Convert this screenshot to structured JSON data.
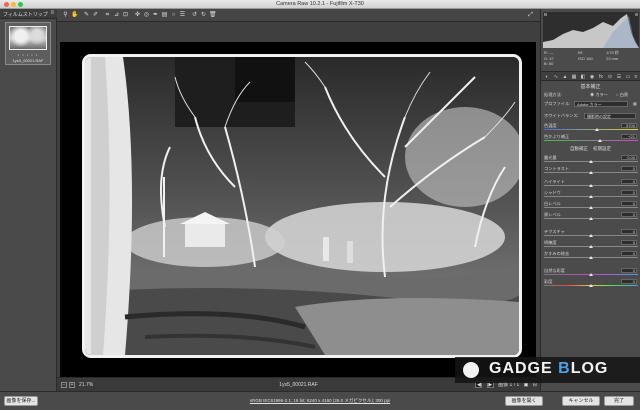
{
  "window": {
    "title": "Camera Raw 10.2.1 - Fujifilm X-T30"
  },
  "filmstrip": {
    "title": "フィルムストリップ",
    "menu_icon": "menu-icon",
    "thumb": {
      "stars": "• • • • •",
      "filename": "1ys5_00021.RAF"
    }
  },
  "toolbar": {
    "tools": [
      "zoom-icon",
      "hand-icon",
      "white-balance-icon",
      "color-sampler-icon",
      "crop-icon",
      "straighten-icon",
      "transform-icon",
      "spot-removal-icon",
      "red-eye-icon",
      "adjustment-brush-icon",
      "graduated-filter-icon",
      "radial-filter-icon",
      "preferences-icon",
      "rotate-left-icon",
      "rotate-right-icon",
      "trash-icon"
    ],
    "right_icon": "fullscreen-icon"
  },
  "status": {
    "zoom": "21.7%",
    "filename": "1ys5_00021.RAF",
    "image_label": "画像 1 / 1"
  },
  "histogram": {
    "readout_left": [
      "R: ---",
      "G: 47",
      "B: 60"
    ],
    "readout_mid": [
      "f/5",
      "ISO 160"
    ],
    "readout_right": [
      "1/70 秒",
      "23 mm"
    ]
  },
  "panel": {
    "section_title": "基本補正",
    "process_label": "処理方法:",
    "process_color": "カラー",
    "process_bw": "白黒",
    "profile_label": "プロファイル:",
    "profile_value": "Adobe カラー",
    "wb_label": "ホワイトバランス:",
    "wb_value": "撮影時の設定",
    "rows": [
      {
        "label": "色温度",
        "value": "5700",
        "knob": 0.55
      },
      {
        "label": "色かぶり補正",
        "value": "+21",
        "knob": 0.58
      }
    ],
    "auto_label": "自動補正",
    "default_label": "初期設定",
    "tone_rows": [
      {
        "label": "露光量",
        "value": "0.00",
        "knob": 0.5
      },
      {
        "label": "コントラスト",
        "value": "0",
        "knob": 0.5
      },
      {
        "label": "ハイライト",
        "value": "0",
        "knob": 0.5
      },
      {
        "label": "シャドウ",
        "value": "0",
        "knob": 0.5
      },
      {
        "label": "白レベル",
        "value": "0",
        "knob": 0.5
      },
      {
        "label": "黒レベル",
        "value": "0",
        "knob": 0.5
      }
    ],
    "presence_rows": [
      {
        "label": "テクスチャ",
        "value": "0",
        "knob": 0.5
      },
      {
        "label": "明瞭度",
        "value": "0",
        "knob": 0.5
      },
      {
        "label": "かすみの除去",
        "value": "0",
        "knob": 0.5
      }
    ],
    "color_rows": [
      {
        "label": "自然な彩度",
        "value": "0",
        "knob": 0.5
      },
      {
        "label": "彩度",
        "value": "0",
        "knob": 0.5
      }
    ]
  },
  "bottom": {
    "save_label": "画像を保存...",
    "workflow": "sRGB IEC61966-2.1; 16 bit; 6240 x 4160 (26.0 メガピクセル); 300 ppi",
    "open_label": "画像を開く",
    "cancel_label": "キャンセル",
    "done_label": "完了"
  },
  "watermark": {
    "text_a": "GADGE ",
    "text_b": "B",
    "text_c": "LOG"
  }
}
